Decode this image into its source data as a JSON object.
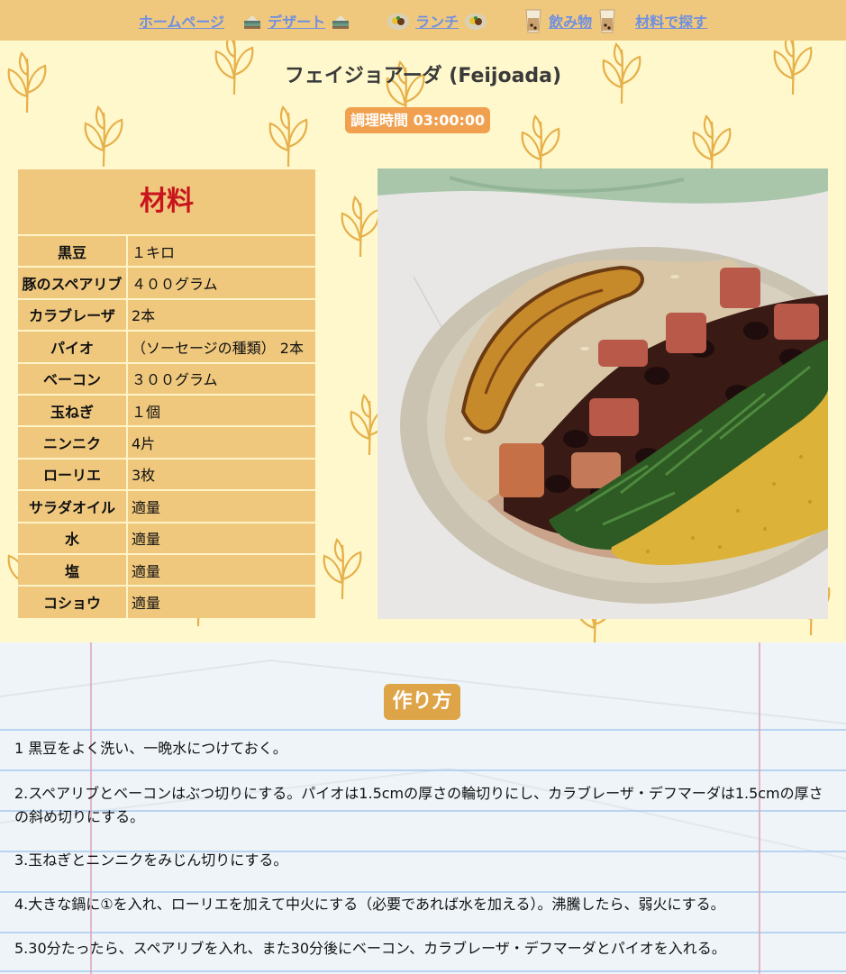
{
  "nav": {
    "items": [
      {
        "label": "ホームページ"
      },
      {
        "label": "デザート"
      },
      {
        "label": "ランチ"
      },
      {
        "label": "飲み物"
      },
      {
        "label": "材料で探す"
      }
    ]
  },
  "recipe": {
    "title": "フェイジョアーダ (Feijoada)",
    "cook_time": "調理時間 03:00:00"
  },
  "ingredients": {
    "heading": "材料",
    "rows": [
      {
        "name": "黒豆",
        "amount": "１キロ"
      },
      {
        "name": "豚のスペアリブ",
        "amount": "４００グラム"
      },
      {
        "name": "カラブレーザ",
        "amount": "2本"
      },
      {
        "name": "パイオ",
        "amount": "（ソーセージの種類） 2本"
      },
      {
        "name": "ベーコン",
        "amount": "３００グラム"
      },
      {
        "name": "玉ねぎ",
        "amount": "１個"
      },
      {
        "name": "ニンニク",
        "amount": "4片"
      },
      {
        "name": "ローリエ",
        "amount": "3枚"
      },
      {
        "name": "サラダオイル",
        "amount": "適量"
      },
      {
        "name": "水",
        "amount": "適量"
      },
      {
        "name": "塩",
        "amount": "適量"
      },
      {
        "name": "コショウ",
        "amount": "適量"
      }
    ]
  },
  "method": {
    "heading": "作り方",
    "steps": [
      "1 黒豆をよく洗い、一晩水につけておく。",
      "2.スペアリブとベーコンはぶつ切りにする。パイオは1.5cmの厚さの輪切りにし、カラブレーザ・デフマーダは1.5cmの厚さの斜め切りにする。",
      "3.玉ねぎとニンニクをみじん切りにする。",
      "4.大きな鍋に①を入れ、ローリエを加えて中火にする（必要であれば水を加える）。沸騰したら、弱火にする。",
      "5.30分たったら、スペアリブを入れ、また30分後にベーコン、カラブレーザ・デフマーダとパイオを入れる。"
    ]
  },
  "colors": {
    "nav_bg": "#efc87e",
    "link": "#6f8fe0",
    "page_bg": "#fff8cc",
    "heading_red": "#c8141c",
    "badge": "#f0a04e",
    "howto_badge": "#dea448"
  }
}
